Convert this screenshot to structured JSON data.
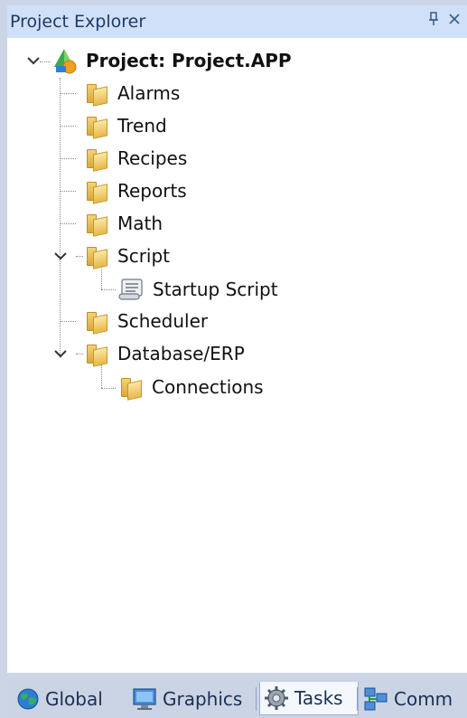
{
  "panel": {
    "title": "Project Explorer",
    "pin_icon": "pin-icon",
    "close_icon": "close-icon"
  },
  "tree": {
    "root": {
      "label": "Project: Project.APP",
      "icon": "project-icon",
      "expanded": true
    },
    "items": [
      {
        "label": "Alarms",
        "icon": "folder-icon"
      },
      {
        "label": "Trend",
        "icon": "folder-icon"
      },
      {
        "label": "Recipes",
        "icon": "folder-icon"
      },
      {
        "label": "Reports",
        "icon": "folder-icon"
      },
      {
        "label": "Math",
        "icon": "folder-icon"
      },
      {
        "label": "Script",
        "icon": "folder-icon",
        "expanded": true,
        "children": [
          {
            "label": "Startup Script",
            "icon": "script-icon"
          }
        ]
      },
      {
        "label": "Scheduler",
        "icon": "folder-icon"
      },
      {
        "label": "Database/ERP",
        "icon": "folder-icon",
        "expanded": true,
        "children": [
          {
            "label": "Connections",
            "icon": "folder-icon"
          }
        ]
      }
    ]
  },
  "tabs": [
    {
      "label": "Global",
      "icon": "globe-icon"
    },
    {
      "label": "Graphics",
      "icon": "monitor-icon"
    },
    {
      "label": "Tasks",
      "icon": "gear-icon",
      "active": true
    },
    {
      "label": "Comm",
      "icon": "network-icon"
    }
  ],
  "colors": {
    "title_bg": "#cfe0f8",
    "title_text": "#1e3a66",
    "panel_border": "#ccd5e6",
    "tree_bg": "#ffffff",
    "active_tab_bg": "#f4f7fc"
  }
}
